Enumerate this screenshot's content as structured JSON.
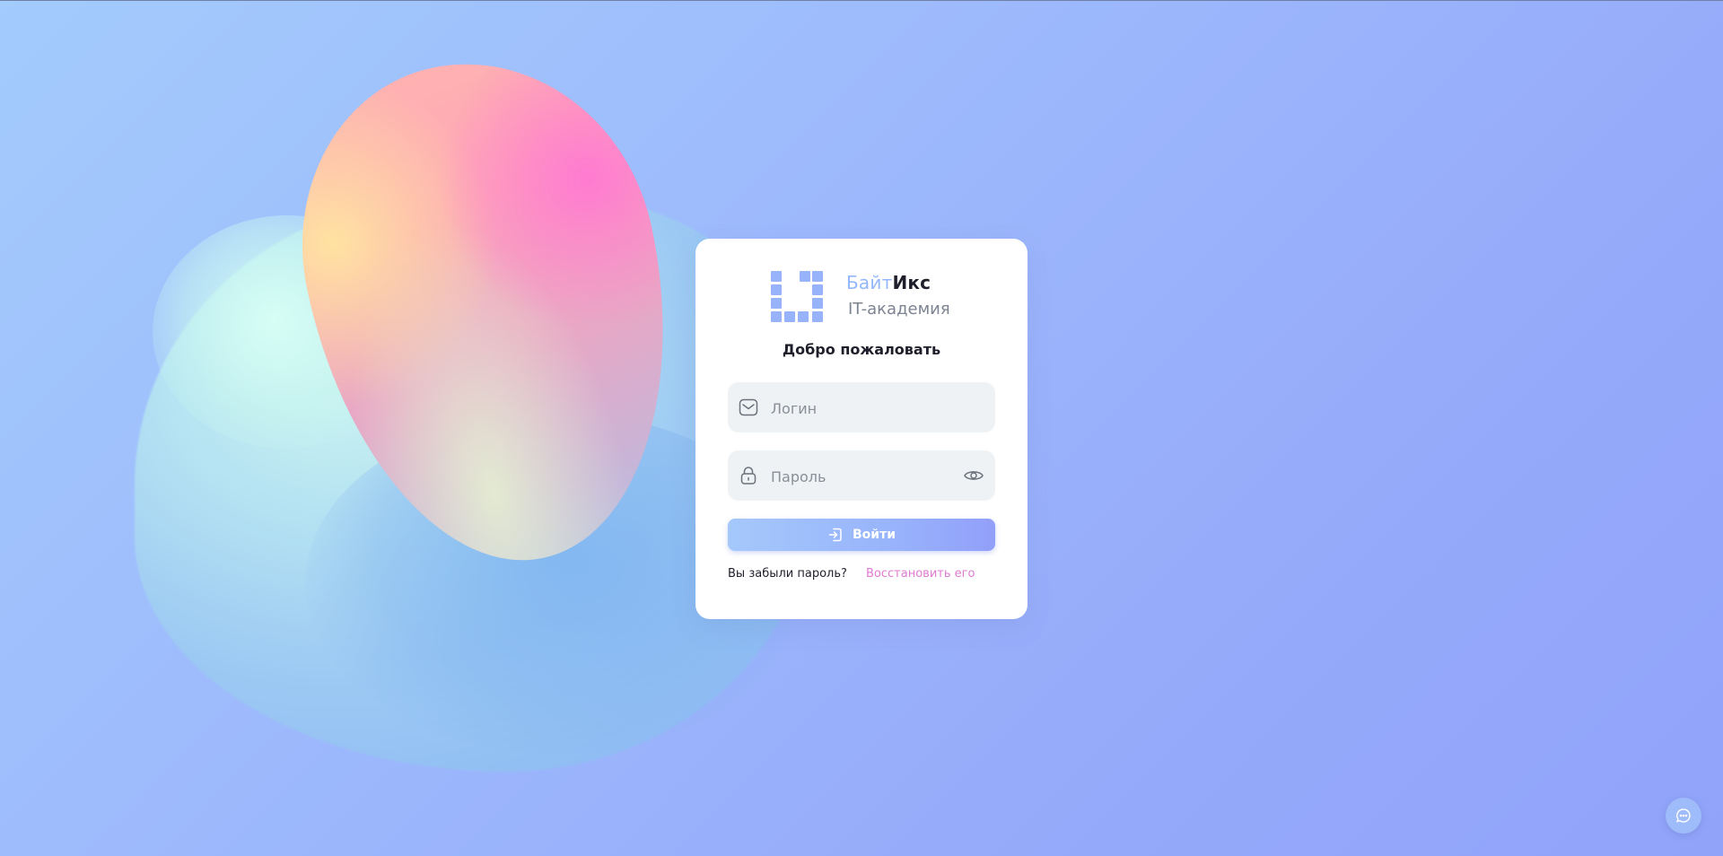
{
  "brand": {
    "name_part1": "Байт",
    "name_part2": "Икс",
    "subtitle": "IT-академия"
  },
  "login_form": {
    "welcome": "Добро пожаловать",
    "login_placeholder": "Логин",
    "password_placeholder": "Пароль",
    "submit_label": "Войти",
    "forgot_text": "Вы забыли пароль?",
    "restore_link": "Восстановить его"
  },
  "icons": {
    "login_field": "mail-icon",
    "password_field": "lock-icon",
    "password_toggle": "eye-icon",
    "submit": "login-arrow-icon",
    "chat": "chat-icon"
  },
  "colors": {
    "accent": "#96b3fb",
    "link": "#e07ad0",
    "card_bg": "#ffffff",
    "field_bg": "#eef2f4"
  }
}
